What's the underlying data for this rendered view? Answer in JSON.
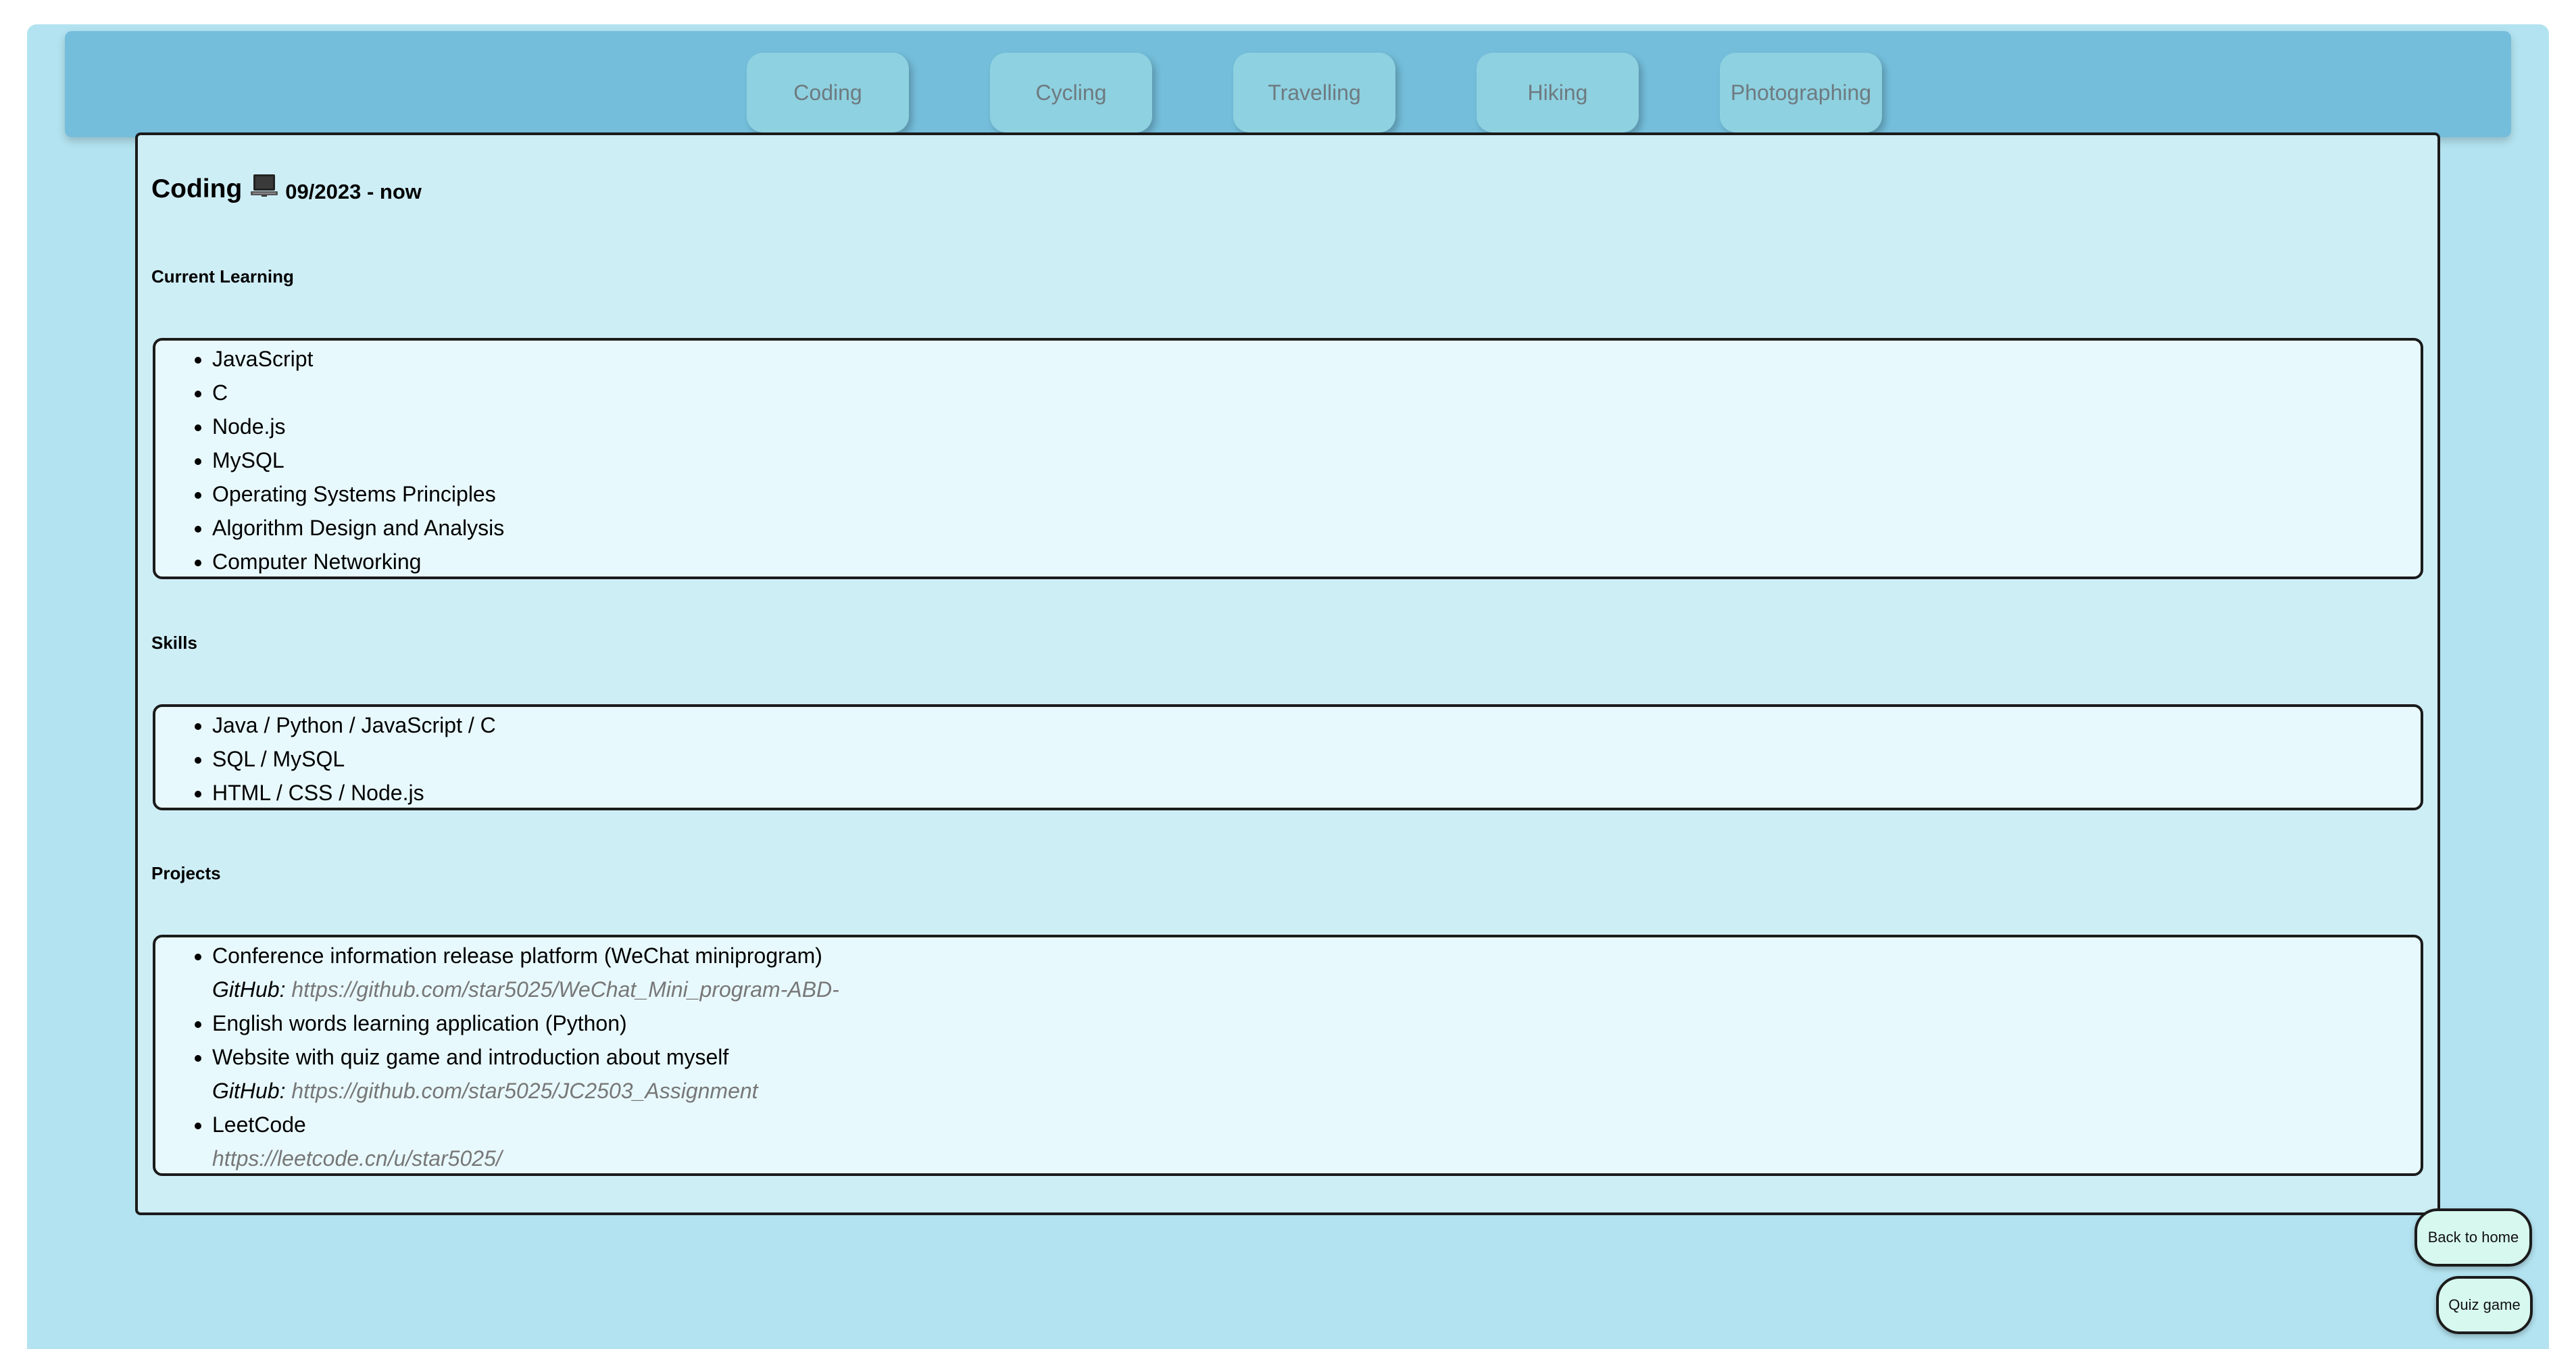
{
  "nav": {
    "tabs": [
      {
        "label": "Coding"
      },
      {
        "label": "Cycling"
      },
      {
        "label": "Travelling"
      },
      {
        "label": "Hiking"
      },
      {
        "label": "Photographing"
      }
    ]
  },
  "content": {
    "title": "Coding",
    "icon": "laptop-icon",
    "date": "09/2023 - now",
    "current_learning": {
      "label": "Current Learning",
      "items": [
        "JavaScript",
        "C",
        "Node.js",
        "MySQL",
        "Operating Systems Principles",
        "Algorithm Design and Analysis",
        "Computer Networking"
      ]
    },
    "skills": {
      "label": "Skills",
      "items": [
        "Java / Python / JavaScript / C",
        "SQL / MySQL",
        "HTML / CSS / Node.js"
      ]
    },
    "projects": {
      "label": "Projects",
      "items": [
        {
          "name": "Conference information release platform (WeChat miniprogram)",
          "link_label": "GitHub:",
          "url": "https://github.com/star5025/WeChat_Mini_program-ABD-"
        },
        {
          "name": "English words learning application (Python)"
        },
        {
          "name": "Website with quiz game and introduction about myself",
          "link_label": "GitHub:",
          "url": "https://github.com/star5025/JC2503_Assignment"
        },
        {
          "name": "LeetCode",
          "url": "https://leetcode.cn/u/star5025/"
        }
      ]
    }
  },
  "buttons": {
    "back_home": "Back to home",
    "quiz_game": "Quiz game"
  },
  "colors": {
    "page_bg": "#b3e3f0",
    "nav_bg": "#74bedb",
    "tab_bg": "#8ed1e0",
    "content_bg": "#ceeef6",
    "box_bg": "#e8f9fd",
    "side_button_bg": "#d7f8ef",
    "link_text": "#777777"
  }
}
